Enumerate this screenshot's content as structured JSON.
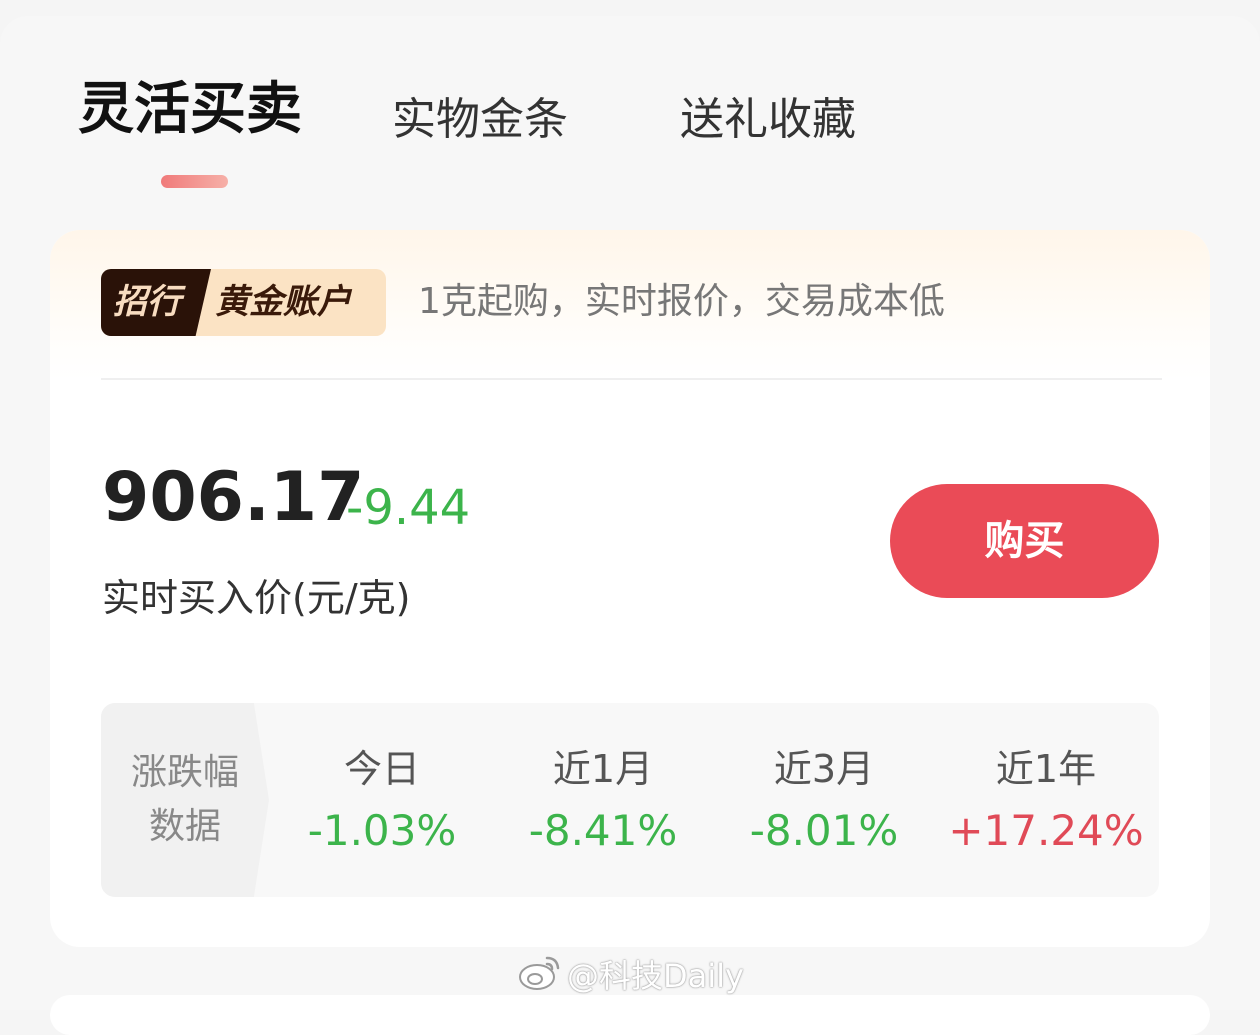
{
  "tabs": [
    {
      "label": "灵活买卖",
      "active": true
    },
    {
      "label": "实物金条",
      "active": false
    },
    {
      "label": "送礼收藏",
      "active": false
    }
  ],
  "account": {
    "badge_left": "招行",
    "badge_right": "黄金账户",
    "slogan": "1克起购，实时报价，交易成本低"
  },
  "quote": {
    "price": "906.17",
    "change": "-9.44",
    "price_label": "实时买入价(元/克)",
    "buy_label": "购买"
  },
  "stats": {
    "header": [
      "涨跌幅",
      "数据"
    ],
    "items": [
      {
        "label": "今日",
        "value": "-1.03%",
        "trend": "down"
      },
      {
        "label": "近1月",
        "value": "-8.41%",
        "trend": "down"
      },
      {
        "label": "近3月",
        "value": "-8.01%",
        "trend": "down"
      },
      {
        "label": "近1年",
        "value": "+17.24%",
        "trend": "up"
      }
    ]
  },
  "colors": {
    "up": "#e04a57",
    "down": "#3cb44b",
    "accent": "#ea4b57"
  },
  "watermark": {
    "icon": "weibo-icon",
    "text": "@科技Daily"
  }
}
